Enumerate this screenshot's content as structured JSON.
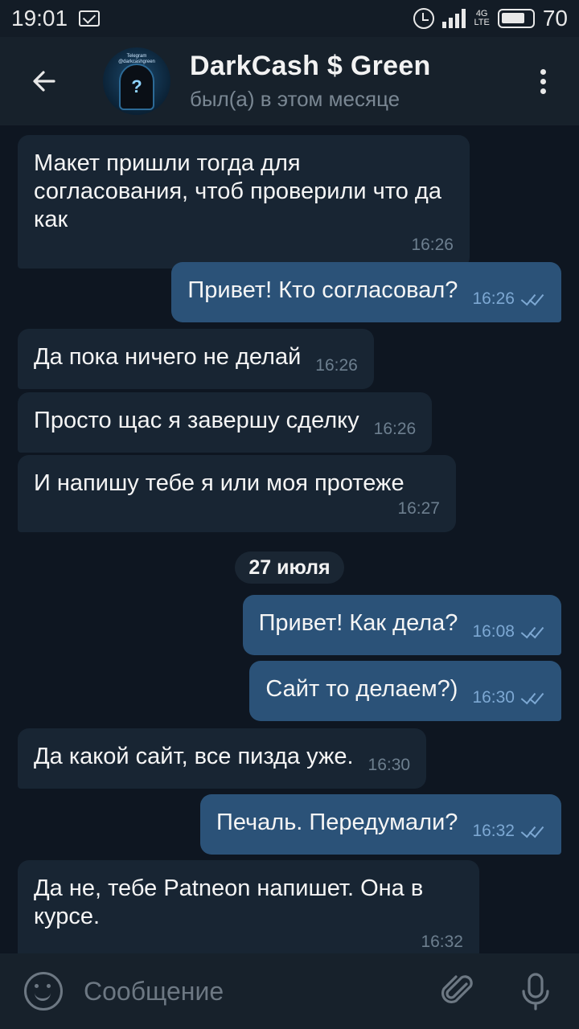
{
  "status_bar": {
    "time": "19:01",
    "network": "4G\nLTE",
    "battery": "70"
  },
  "header": {
    "name": "DarkCash $ Green",
    "status": "был(а) в этом месяце",
    "avatar_caption": "Telegram\n@darkcashgreen"
  },
  "messages": [
    {
      "dir": "in",
      "text": "Макет пришли тогда для согласования, чтоб проверили что да как",
      "time": "16:26"
    },
    {
      "dir": "out",
      "text": "Привет! Кто согласовал?",
      "time": "16:26",
      "read": true
    },
    {
      "dir": "in",
      "text": "Да пока ничего не делай",
      "time": "16:26"
    },
    {
      "dir": "in",
      "text": "Просто щас я завершу сделку",
      "time": "16:26"
    },
    {
      "dir": "in",
      "text": "И напишу тебе я или моя протеже",
      "time": "16:27"
    },
    {
      "dir": "out",
      "text": "Привет! Как дела?",
      "time": "16:08",
      "read": true
    },
    {
      "dir": "out",
      "text": "Сайт то делаем?)",
      "time": "16:30",
      "read": true
    },
    {
      "dir": "in",
      "text": "Да какой сайт, все пизда уже.",
      "time": "16:30"
    },
    {
      "dir": "out",
      "text": "Печаль. Передумали?",
      "time": "16:32",
      "read": true
    },
    {
      "dir": "in",
      "text": "Да не, тебе Patneon напишет. Она в курсе.",
      "time": "16:32"
    }
  ],
  "date_separator": "27 июля",
  "input": {
    "placeholder": "Сообщение"
  },
  "colors": {
    "background": "#0e1621",
    "header": "#17212b",
    "incoming_bubble": "#182533",
    "outgoing_bubble": "#2b5278",
    "meta_in": "#6d7f8f",
    "meta_out": "#7da8d3"
  },
  "icons": {
    "back": "arrow-left-icon",
    "menu": "more-vertical-icon",
    "emoji": "emoji-icon",
    "attach": "paperclip-icon",
    "mic": "microphone-icon",
    "read": "double-check-icon"
  }
}
